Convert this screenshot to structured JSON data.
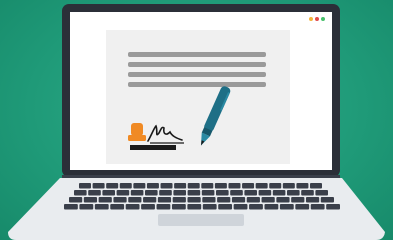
{
  "colors": {
    "background": "#1f9a78",
    "laptop_bezel": "#2b2f38",
    "screen_bg": "#ffffff",
    "document_bg": "#f0f0f0",
    "text_line": "#9a9a9a",
    "pen_body": "#1e6f86",
    "stamp": "#f08a24",
    "keyboard_keys": "#3a3f4a",
    "laptop_base": "#e9ecef",
    "trackpad": "#cfd4da",
    "window_dots": [
      "#f4b43a",
      "#e04b4b",
      "#48c06b"
    ]
  },
  "illustration": {
    "document_text_lines": 4,
    "elements": [
      "laptop",
      "document",
      "pen",
      "signature",
      "stamp"
    ]
  }
}
